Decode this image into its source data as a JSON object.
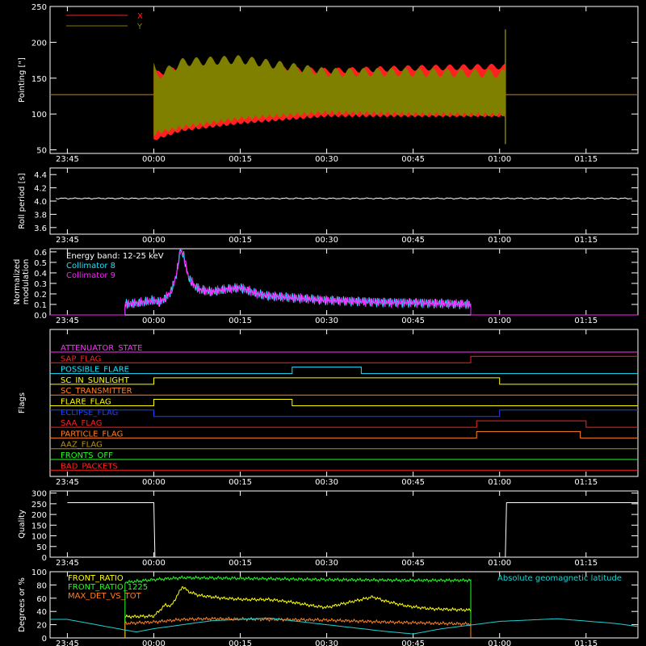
{
  "colors": {
    "background": "#000000",
    "axes": "#ffffff",
    "x_series": "#ff2020",
    "y_series": "#808000",
    "collimator8": "#20e0ff",
    "collimator9": "#ff20ff",
    "front_ratio": "#ffff00",
    "front_ratio_1225": "#20ff20",
    "max_det_vs_tot": "#ff8020",
    "geomag_lat": "#20d0d0"
  },
  "time_axis": {
    "start": "23:42",
    "end": "01:24",
    "ticks": [
      "23:45",
      "00:00",
      "00:15",
      "00:30",
      "00:45",
      "01:00",
      "01:15"
    ]
  },
  "chart_data": [
    {
      "type": "line",
      "panel": "pointing",
      "ylabel": "Pointing [\"]",
      "ylim": [
        45,
        250
      ],
      "yticks": [
        50,
        100,
        150,
        200,
        250
      ],
      "series": [
        {
          "name": "X",
          "baseline": 127,
          "start": "00:00",
          "end": "01:01",
          "envelope": [
            [
              0,
              65,
              165
            ],
            [
              0.5,
              68,
              156
            ],
            [
              5,
              80,
              165
            ],
            [
              15,
              90,
              165
            ],
            [
              30,
              100,
              160
            ],
            [
              45,
              100,
              164
            ],
            [
              60,
              100,
              166
            ],
            [
              61,
              100,
              166
            ]
          ]
        },
        {
          "name": "Y",
          "baseline": 127,
          "start": "00:00",
          "end": "01:01",
          "envelope": [
            [
              0,
              75,
              165
            ],
            [
              0.5,
              78,
              152
            ],
            [
              5,
              86,
              172
            ],
            [
              15,
              98,
              176
            ],
            [
              30,
              106,
              158
            ],
            [
              45,
              104,
              158
            ],
            [
              60,
              103,
              156
            ],
            [
              61,
              103,
              156
            ]
          ]
        }
      ],
      "spike": {
        "time": "01:01",
        "min": 58,
        "max": 218
      }
    },
    {
      "type": "line",
      "panel": "roll",
      "ylabel": "Roll period [s]",
      "ylim": [
        3.5,
        4.5
      ],
      "yticks": [
        "3.6",
        "3.8",
        "4.0",
        "4.2",
        "4.4"
      ],
      "series": [
        {
          "name": "",
          "value": 4.04
        }
      ]
    },
    {
      "type": "line",
      "panel": "modulation",
      "ylabel": "Normalized modulation",
      "ylim": [
        0,
        0.63
      ],
      "yticks": [
        "0.0",
        "0.1",
        "0.2",
        "0.3",
        "0.4",
        "0.5",
        "0.6"
      ],
      "legend": [
        "Energy band: 12-25 keV",
        "Collimator 8",
        "Collimator 9"
      ],
      "start": "23:55",
      "end": "00:55",
      "points": [
        [
          -5,
          0.1
        ],
        [
          -2,
          0.12
        ],
        [
          0,
          0.14
        ],
        [
          1,
          0.12
        ],
        [
          2,
          0.16
        ],
        [
          3,
          0.22
        ],
        [
          4,
          0.4
        ],
        [
          4.6,
          0.62
        ],
        [
          5.2,
          0.56
        ],
        [
          6,
          0.36
        ],
        [
          7,
          0.28
        ],
        [
          8,
          0.24
        ],
        [
          10,
          0.22
        ],
        [
          12,
          0.24
        ],
        [
          15,
          0.26
        ],
        [
          18,
          0.2
        ],
        [
          20,
          0.18
        ],
        [
          25,
          0.16
        ],
        [
          30,
          0.14
        ],
        [
          40,
          0.12
        ],
        [
          50,
          0.11
        ],
        [
          55,
          0.1
        ]
      ]
    },
    {
      "type": "line",
      "panel": "flags",
      "ylabel": "Flags",
      "flags": [
        {
          "name": "ATTENUATOR_STATE",
          "color": "#ff30ff",
          "segments": [
            [
              -5,
              0
            ]
          ]
        },
        {
          "name": "SAP_FLAG",
          "color": "#ff2020",
          "segments": [
            [
              -5,
              0
            ],
            [
              55,
              1
            ]
          ]
        },
        {
          "name": "POSSIBLE_FLARE",
          "color": "#20e0ff",
          "segments": [
            [
              -5,
              0
            ],
            [
              24,
              1
            ],
            [
              36,
              0
            ]
          ]
        },
        {
          "name": "SC_IN_SUNLIGHT",
          "color": "#ffff00",
          "segments": [
            [
              -5,
              0
            ],
            [
              0,
              1
            ],
            [
              60,
              0
            ]
          ]
        },
        {
          "name": "SC_TRANSMITTER",
          "color": "#ff8020",
          "segments": [
            [
              -5,
              0
            ]
          ]
        },
        {
          "name": "FLARE_FLAG",
          "color": "#ffff00",
          "segments": [
            [
              -5,
              0
            ],
            [
              0,
              1
            ],
            [
              24,
              0
            ]
          ]
        },
        {
          "name": "ECLIPSE_FLAG",
          "color": "#2040ff",
          "segments": [
            [
              -5,
              1
            ],
            [
              0,
              0
            ],
            [
              60,
              1
            ]
          ]
        },
        {
          "name": "SAA_FLAG",
          "color": "#ff2020",
          "segments": [
            [
              -5,
              0
            ],
            [
              56,
              1
            ],
            [
              75,
              0
            ]
          ]
        },
        {
          "name": "PARTICLE_FLAG",
          "color": "#ff8020",
          "segments": [
            [
              -5,
              0
            ],
            [
              56,
              1
            ],
            [
              74,
              0
            ]
          ]
        },
        {
          "name": "AAZ_FLAG",
          "color": "#c09000",
          "segments": [
            [
              -5,
              0
            ]
          ]
        },
        {
          "name": "FRONTS_OFF",
          "color": "#20ff20",
          "segments": [
            [
              -5,
              0
            ]
          ]
        },
        {
          "name": "BAD_PACKETS",
          "color": "#ff2020",
          "segments": [
            [
              -5,
              0
            ]
          ]
        }
      ]
    },
    {
      "type": "line",
      "panel": "quality",
      "ylabel": "Quality",
      "ylim": [
        0,
        310
      ],
      "yticks": [
        0,
        50,
        100,
        150,
        200,
        250,
        300
      ],
      "points": [
        [
          -15,
          255
        ],
        [
          0,
          255
        ],
        [
          0.2,
          0
        ],
        [
          61,
          0
        ],
        [
          61.2,
          255
        ],
        [
          100,
          255
        ]
      ]
    },
    {
      "type": "line",
      "panel": "ratios",
      "ylabel": "Degrees or %",
      "ylim": [
        0,
        100
      ],
      "yticks": [
        0,
        20,
        40,
        60,
        80,
        100
      ],
      "legend_right": "Absolute geomagnetic latitude",
      "start": "23:55",
      "end": "00:55",
      "series": [
        {
          "name": "FRONT_RATIO",
          "points": [
            [
              -5,
              32
            ],
            [
              0,
              33
            ],
            [
              2,
              50
            ],
            [
              3,
              48
            ],
            [
              5,
              78
            ],
            [
              6,
              70
            ],
            [
              8,
              64
            ],
            [
              12,
              60
            ],
            [
              16,
              58
            ],
            [
              20,
              58
            ],
            [
              24,
              54
            ],
            [
              28,
              48
            ],
            [
              30,
              46
            ],
            [
              36,
              58
            ],
            [
              38,
              62
            ],
            [
              40,
              56
            ],
            [
              44,
              48
            ],
            [
              48,
              44
            ],
            [
              55,
              42
            ]
          ]
        },
        {
          "name": "FRONT_RATIO_1225",
          "points": [
            [
              -5,
              84
            ],
            [
              0,
              88
            ],
            [
              5,
              91
            ],
            [
              15,
              90
            ],
            [
              30,
              88
            ],
            [
              45,
              87
            ],
            [
              55,
              87
            ]
          ]
        },
        {
          "name": "MAX_DET_VS_TOT",
          "points": [
            [
              -5,
              22
            ],
            [
              0,
              24
            ],
            [
              5,
              28
            ],
            [
              10,
              29
            ],
            [
              20,
              28
            ],
            [
              30,
              27
            ],
            [
              40,
              24
            ],
            [
              50,
              22
            ],
            [
              55,
              21
            ]
          ]
        },
        {
          "name": "Absolute geomagnetic latitude",
          "points": [
            [
              -15,
              28
            ],
            [
              -5,
              12
            ],
            [
              -3,
              9
            ],
            [
              0,
              14
            ],
            [
              10,
              26
            ],
            [
              20,
              30
            ],
            [
              30,
              20
            ],
            [
              40,
              10
            ],
            [
              45,
              6
            ],
            [
              50,
              14
            ],
            [
              60,
              25
            ],
            [
              70,
              29
            ],
            [
              80,
              22
            ],
            [
              90,
              10
            ],
            [
              96,
              4
            ],
            [
              99,
              2
            ]
          ]
        }
      ]
    }
  ]
}
